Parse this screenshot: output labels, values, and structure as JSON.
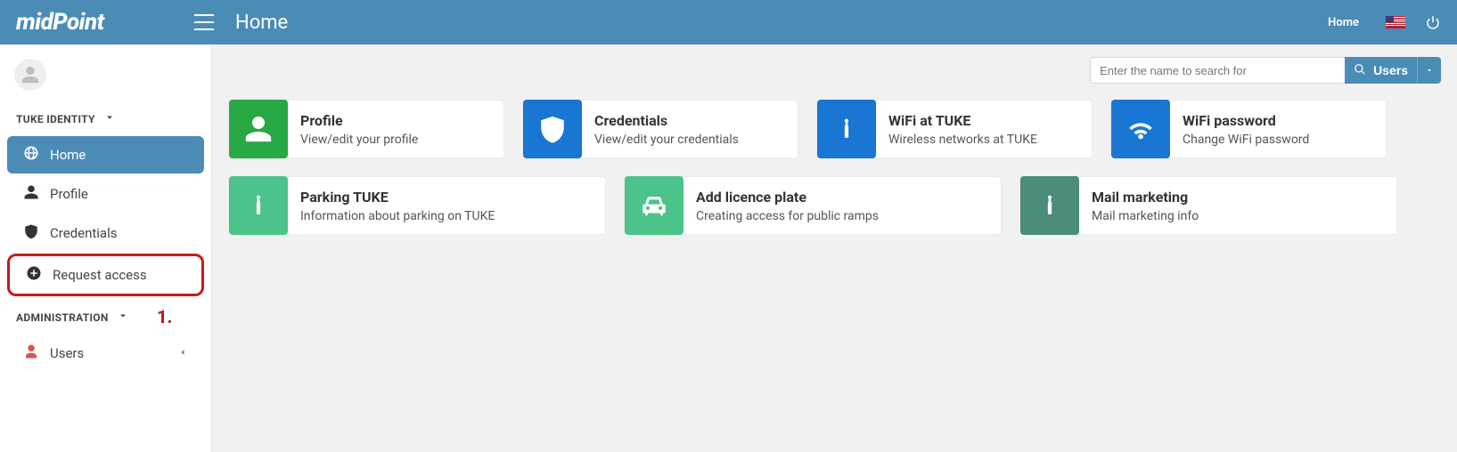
{
  "brand": "midPoint",
  "header": {
    "page_title": "Home",
    "breadcrumb": "Home"
  },
  "search": {
    "placeholder": "Enter the name to search for",
    "button_label": "Users"
  },
  "sidebar": {
    "sections": [
      {
        "label": "TUKE IDENTITY",
        "items": [
          {
            "label": "Home",
            "icon": "globe-icon",
            "active": true
          },
          {
            "label": "Profile",
            "icon": "person-icon"
          },
          {
            "label": "Credentials",
            "icon": "shield-icon"
          },
          {
            "label": "Request access",
            "icon": "plus-circle-icon",
            "highlight": true
          }
        ]
      },
      {
        "label": "ADMINISTRATION",
        "items": [
          {
            "label": "Users",
            "icon": "user-icon",
            "submenu": true,
            "accent": "#d9534f"
          }
        ]
      }
    ]
  },
  "annotation": "1.",
  "cards": [
    {
      "title": "Profile",
      "desc": "View/edit your profile",
      "icon": "person-icon",
      "color": "c-green",
      "width": "w1"
    },
    {
      "title": "Credentials",
      "desc": "View/edit your credentials",
      "icon": "shield-icon",
      "color": "c-blue",
      "width": "w1"
    },
    {
      "title": "WiFi at TUKE",
      "desc": "Wireless networks at TUKE",
      "icon": "info-icon",
      "color": "c-blue",
      "width": "w1"
    },
    {
      "title": "WiFi password",
      "desc": "Change WiFi password",
      "icon": "wifi-icon",
      "color": "c-blue",
      "width": "w1"
    },
    {
      "title": "Parking TUKE",
      "desc": "Information about parking on TUKE",
      "icon": "info-icon",
      "color": "c-teal",
      "width": "w2"
    },
    {
      "title": "Add licence plate",
      "desc": "Creating access for public ramps",
      "icon": "car-icon",
      "color": "c-teal",
      "width": "w2"
    },
    {
      "title": "Mail marketing",
      "desc": "Mail marketing info",
      "icon": "info-icon",
      "color": "c-slate",
      "width": "w2"
    }
  ]
}
